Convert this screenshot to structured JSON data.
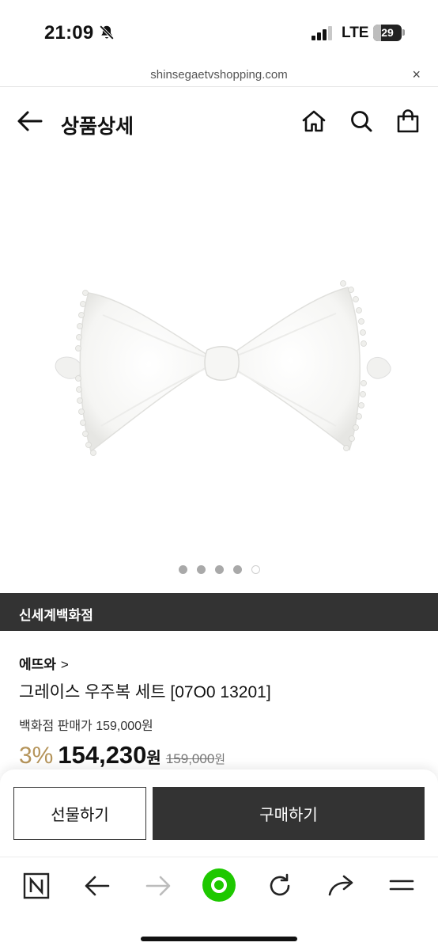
{
  "status_bar": {
    "time": "21:09",
    "network": "LTE",
    "battery": "29",
    "battery_level": 0.29,
    "icons": [
      "bell-slash-icon",
      "signal-icon",
      "battery-icon"
    ]
  },
  "url_bar": {
    "url": "shinsegaetvshopping.com",
    "close_label": "×"
  },
  "header": {
    "title": "상품상세",
    "icons": [
      "arrow-left-icon",
      "home-icon",
      "search-icon",
      "shopping-bag-icon"
    ]
  },
  "gallery": {
    "image": "white-bow-hairpin-photo",
    "total_slides": 5,
    "current_slide": 5
  },
  "store": {
    "name": "신세계백화점"
  },
  "product": {
    "brand": "에뜨와",
    "brand_chevron": ">",
    "name": "그레이스 우주복 세트 [07O0 13201]",
    "dept_price_label": "백화점 판매가 159,000원",
    "discount": "3%",
    "sale_price": "154,230",
    "sale_currency": "원",
    "original_price": "159,000",
    "original_currency": "원"
  },
  "actions": {
    "gift_label": "선물하기",
    "buy_label": "구매하기"
  },
  "toolbar": {
    "icons": [
      "naver-n-icon",
      "back-arrow-icon",
      "forward-arrow-icon",
      "green-home-dot-icon",
      "reload-icon",
      "share-icon",
      "menu-icon"
    ],
    "accent_color": "#1ec800"
  }
}
